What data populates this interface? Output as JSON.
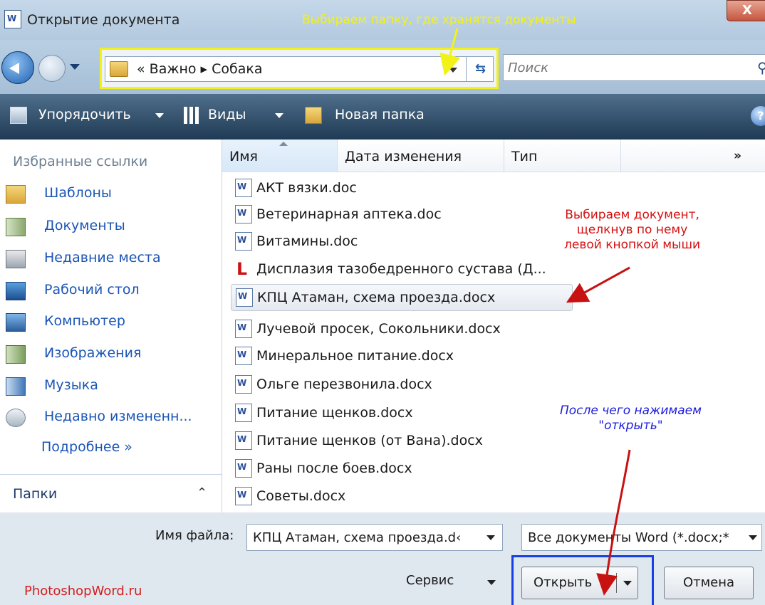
{
  "window": {
    "title": "Открытие документа",
    "close_label": "X",
    "app_icon_label": "W"
  },
  "address_bar": {
    "crumbs": "« Важно ▸ Собака"
  },
  "search": {
    "placeholder": "Поиск"
  },
  "toolbar": {
    "organize": "Упорядочить",
    "views": "Виды",
    "new_folder": "Новая папка"
  },
  "nav_pane": {
    "favorites_title": "Избранные ссылки",
    "items": [
      {
        "label": "Шаблоны",
        "icon": "templates-folder-icon"
      },
      {
        "label": "Документы",
        "icon": "documents-icon"
      },
      {
        "label": "Недавние места",
        "icon": "recent-places-icon"
      },
      {
        "label": "Рабочий стол",
        "icon": "desktop-icon"
      },
      {
        "label": "Компьютер",
        "icon": "computer-icon"
      },
      {
        "label": "Изображения",
        "icon": "pictures-icon"
      },
      {
        "label": "Музыка",
        "icon": "music-icon"
      },
      {
        "label": "Недавно измененн...",
        "icon": "recently-changed-icon"
      }
    ],
    "more_label": "Подробнее »",
    "folders_label": "Папки"
  },
  "columns": {
    "name": "Имя",
    "modified": "Дата изменения",
    "type": "Тип",
    "more": "»"
  },
  "files": [
    {
      "name": "АКТ вязки.doc",
      "kind": "word"
    },
    {
      "name": "Ветеринарная аптека.doc",
      "kind": "word"
    },
    {
      "name": "Витамины.doc",
      "kind": "word"
    },
    {
      "name": "Дисплазия тазобедренного сустава (Д...",
      "kind": "pdf"
    },
    {
      "name": "КПЦ Атаман, схема проезда.docx",
      "kind": "word",
      "selected": true
    },
    {
      "name": "Лучевой просек, Сокольники.docx",
      "kind": "word"
    },
    {
      "name": "Минеральное питание.docx",
      "kind": "word"
    },
    {
      "name": "Ольге перезвонила.docx",
      "kind": "word"
    },
    {
      "name": "Питание щенков.docx",
      "kind": "word"
    },
    {
      "name": "Питание щенков (от Вана).docx",
      "kind": "word"
    },
    {
      "name": "Раны после боев.docx",
      "kind": "word"
    },
    {
      "name": "Советы.docx",
      "kind": "word"
    }
  ],
  "bottom": {
    "filename_label": "Имя файла:",
    "filename_value": "КПЦ Атаман, схема проезда.d‹",
    "filetype_value": "Все документы Word (*.docx;*",
    "service_label": "Сервис",
    "open_label": "Открыть",
    "cancel_label": "Отмена",
    "watermark": "PhotoshopWord.ru"
  },
  "annotations": {
    "folder_hint": "Выбираем папку, где хранятся документы",
    "doc_hint_1": "Выбираем документ,",
    "doc_hint_2": "щелкнув по нему",
    "doc_hint_3": "левой кнопкой мыши",
    "open_hint_1": "После чего нажимаем",
    "open_hint_2": "\"открыть\""
  },
  "colors": {
    "annotation_yellow": "#f2f218",
    "annotation_red": "#d51010",
    "annotation_blue": "#1a1adf",
    "link_blue": "#1a55b5"
  }
}
